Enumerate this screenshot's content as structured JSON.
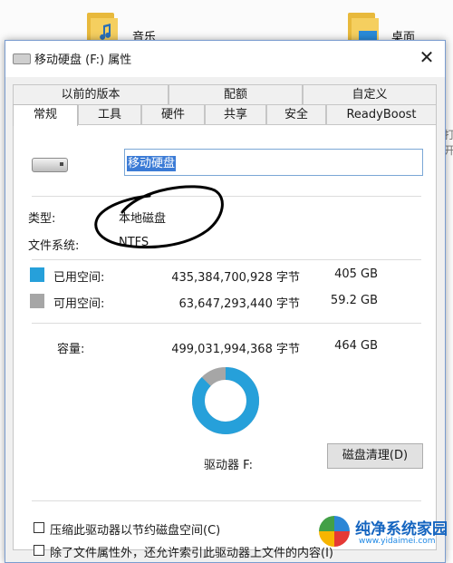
{
  "background": {
    "folder_music_label": "音乐",
    "folder_desktop_label": "桌面",
    "right_edge_text": "打开"
  },
  "dialog": {
    "title": "移动硬盘 (F:) 属性",
    "close_glyph": "✕",
    "tabs_top": [
      "以前的版本",
      "配额",
      "自定义"
    ],
    "tabs_bottom": [
      "常规",
      "工具",
      "硬件",
      "共享",
      "安全",
      "ReadyBoost"
    ],
    "active_tab": "常规",
    "volume_name": "移动硬盘",
    "type_label": "类型:",
    "type_value": "本地磁盘",
    "fs_label": "文件系统:",
    "fs_value": "NTFS",
    "used_label": "已用空间:",
    "used_bytes": "435,384,700,928 字节",
    "used_size": "405 GB",
    "free_label": "可用空间:",
    "free_bytes": "63,647,293,440 字节",
    "free_size": "59.2 GB",
    "capacity_label": "容量:",
    "capacity_bytes": "499,031,994,368 字节",
    "capacity_size": "464 GB",
    "drive_label": "驱动器 F:",
    "cleanup_button": "磁盘清理(D)",
    "compress_label": "压缩此驱动器以节约磁盘空间(C)",
    "index_label": "除了文件属性外，还允许索引此驱动器上文件的内容(I)",
    "used_fraction": 0.8725,
    "used_color": "#26a0da",
    "free_color": "#a6a6a6"
  },
  "watermark": {
    "text": "纯净系统家园",
    "url": "www.yidaimei.com"
  }
}
